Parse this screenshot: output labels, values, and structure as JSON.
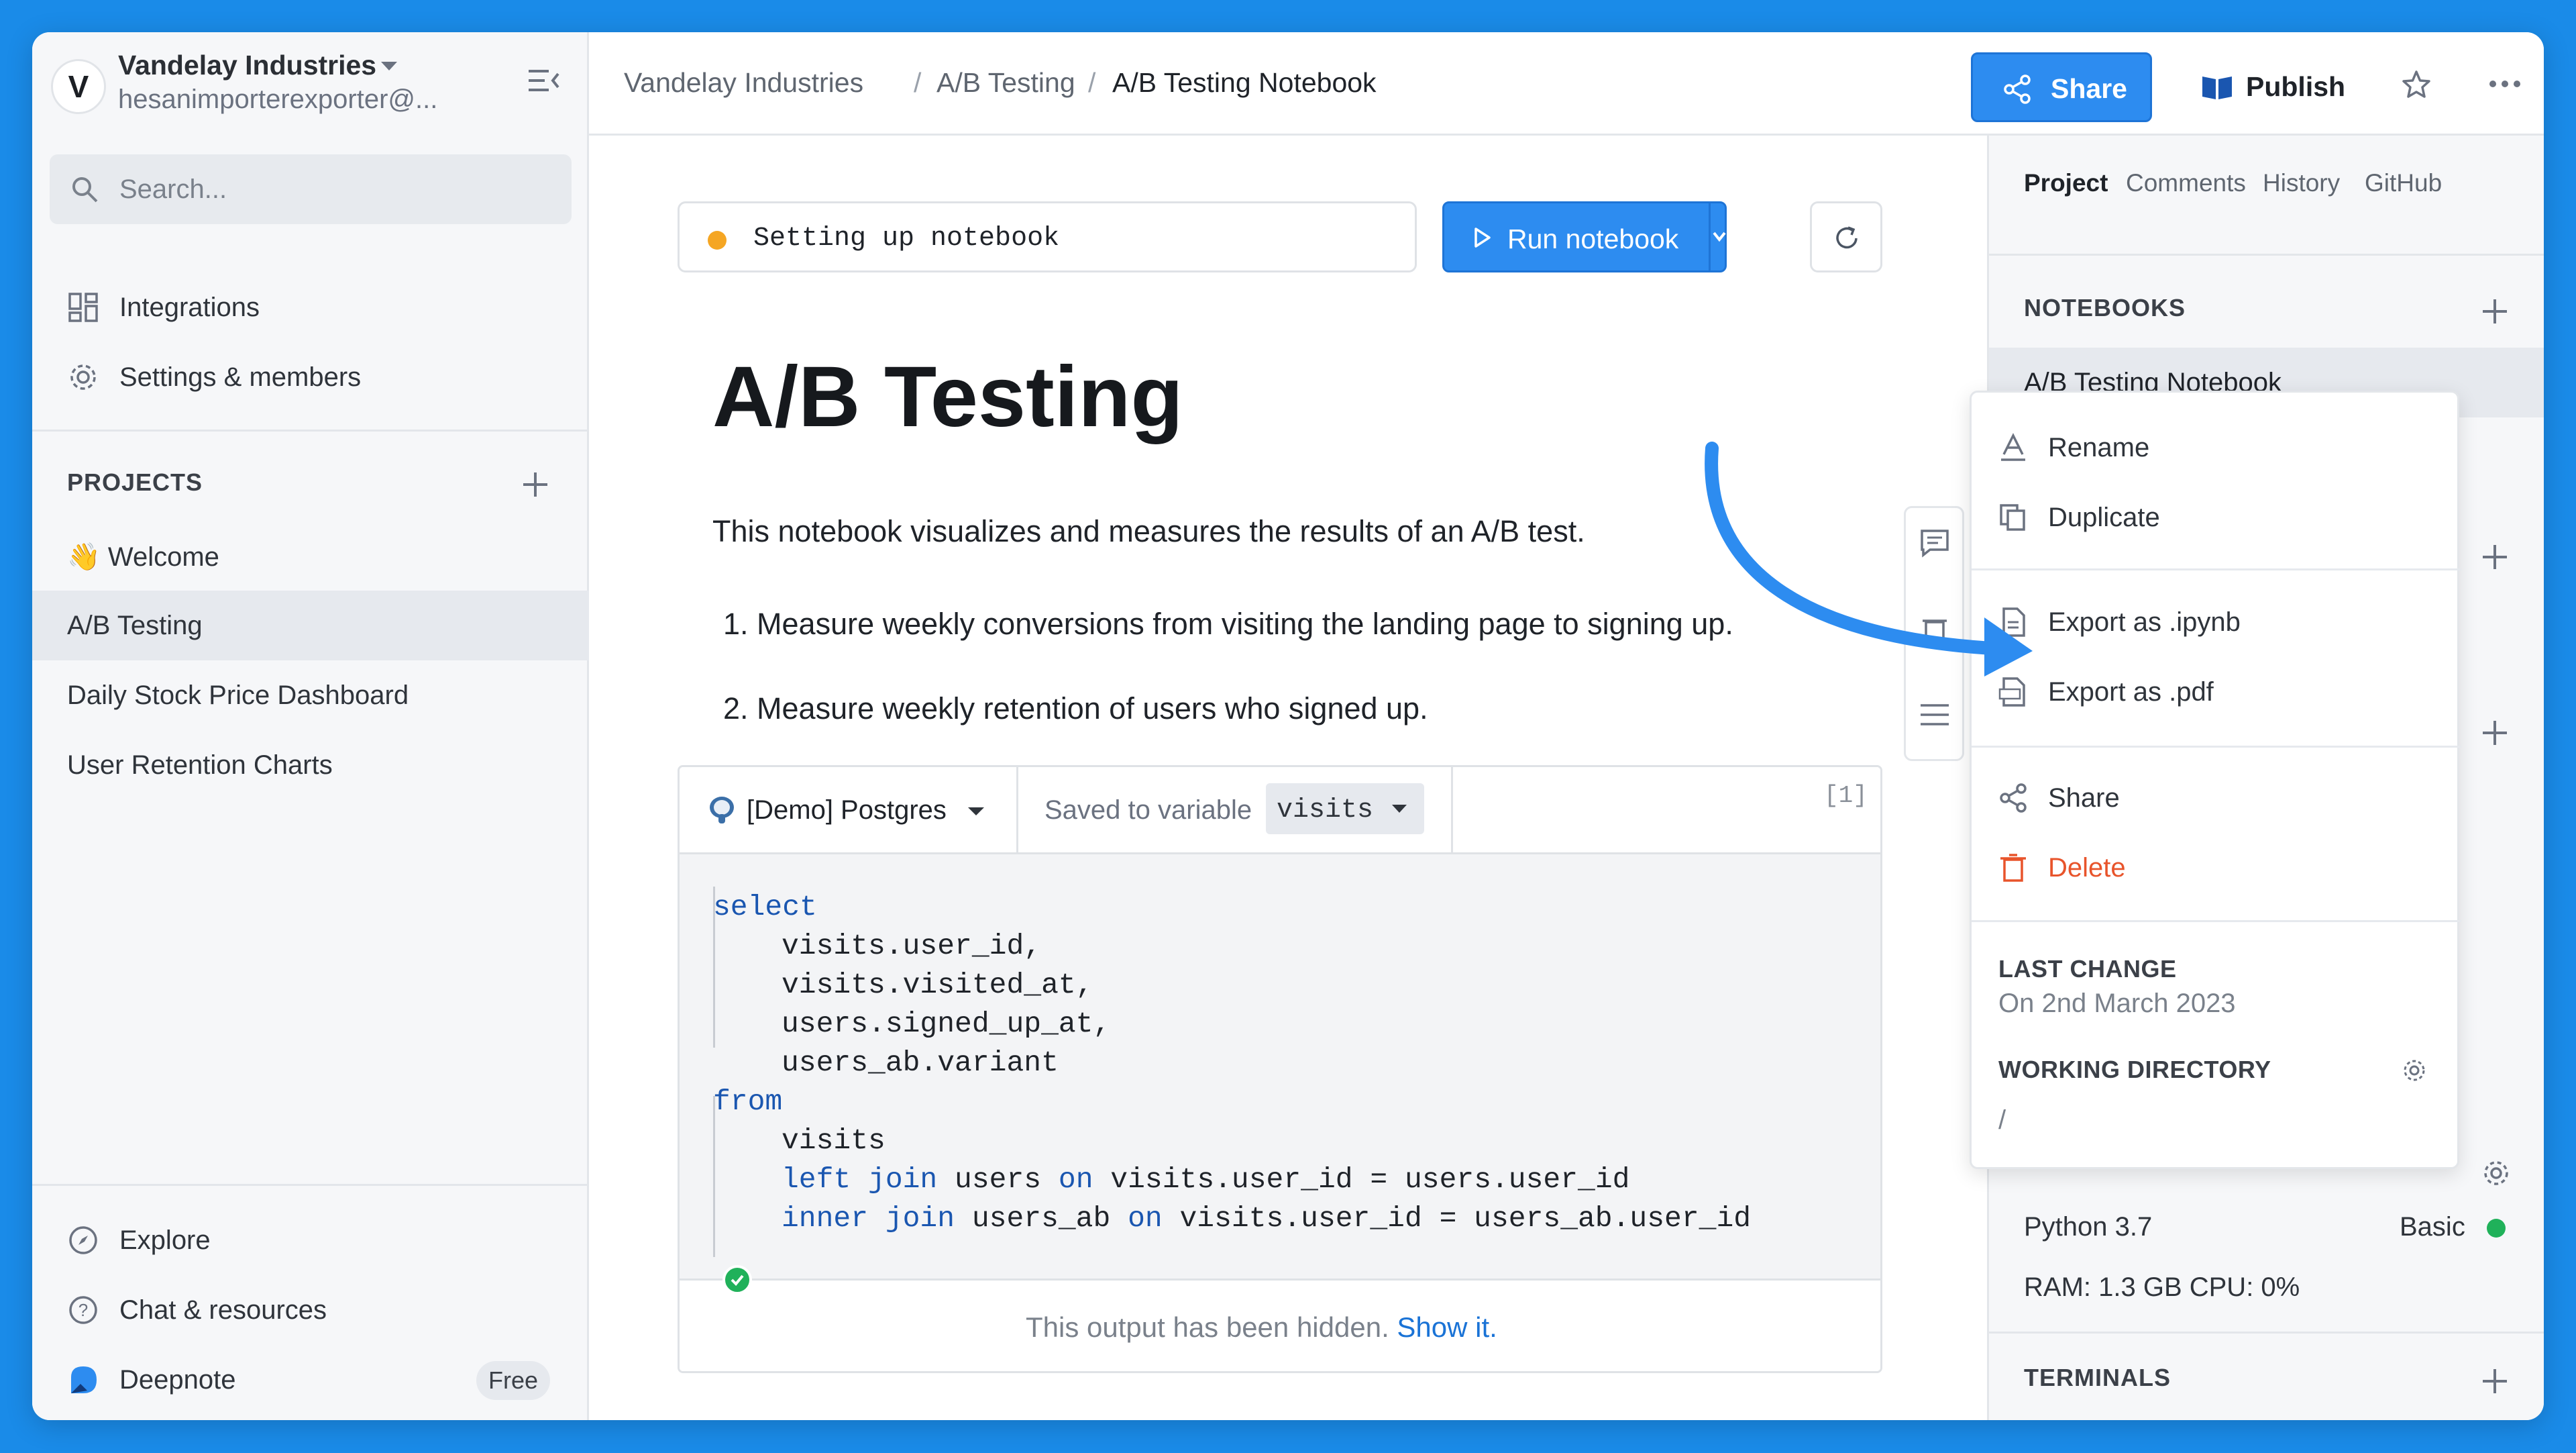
{
  "workspace": {
    "name": "Vandelay Industries",
    "email": "hesanimporterexporter@..."
  },
  "search": {
    "placeholder": "Search..."
  },
  "nav": [
    {
      "label": "Integrations",
      "icon": "grid-icon"
    },
    {
      "label": "Settings & members",
      "icon": "gear-icon"
    }
  ],
  "projects": {
    "title": "PROJECTS",
    "items": [
      {
        "label": "👋 Welcome",
        "active": false
      },
      {
        "label": "A/B Testing",
        "active": true
      },
      {
        "label": "Daily Stock Price Dashboard",
        "active": false
      },
      {
        "label": "User Retention Charts",
        "active": false
      }
    ]
  },
  "footer": {
    "explore": "Explore",
    "chat": "Chat & resources",
    "product": "Deepnote",
    "plan": "Free"
  },
  "breadcrumb": [
    "Vandelay Industries",
    "/",
    "A/B Testing",
    "/",
    "A/B Testing Notebook"
  ],
  "header": {
    "share": "Share",
    "publish": "Publish"
  },
  "notebook": {
    "status": "Setting up notebook",
    "run_label": "Run notebook",
    "title": "A/B Testing",
    "intro": "This notebook visualizes and measures the results of an A/B test.",
    "list": [
      "1. Measure weekly conversions from visiting the landing page to signing up.",
      "2. Measure weekly retention of users who signed up."
    ]
  },
  "cell": {
    "database": "[Demo] Postgres",
    "saved_to": "Saved to variable",
    "variable": "visits",
    "exec_count": "[1]",
    "output_hidden": "This output has been hidden.",
    "show_link": "Show it."
  },
  "right_panel": {
    "tabs": [
      "Project",
      "Comments",
      "History",
      "GitHub"
    ],
    "notebooks_title": "NOTEBOOKS",
    "notebook_item": "A/B Testing Notebook",
    "python": "Python 3.7",
    "machine": "Basic",
    "resources": "RAM: 1.3 GB  CPU: 0%",
    "terminals": "TERMINALS"
  },
  "menu": {
    "items": [
      "Rename",
      "Duplicate",
      "Export as .ipynb",
      "Export as .pdf",
      "Share",
      "Delete"
    ],
    "last_change_title": "LAST CHANGE",
    "last_change_value": "On 2nd March 2023",
    "workdir_title": "WORKING DIRECTORY",
    "workdir_value": "/"
  },
  "colors": {
    "accent": "#2d8cf0",
    "background": "#1a8be8",
    "danger": "#e8542b",
    "success": "#20b15a",
    "status": "#f5a623"
  }
}
